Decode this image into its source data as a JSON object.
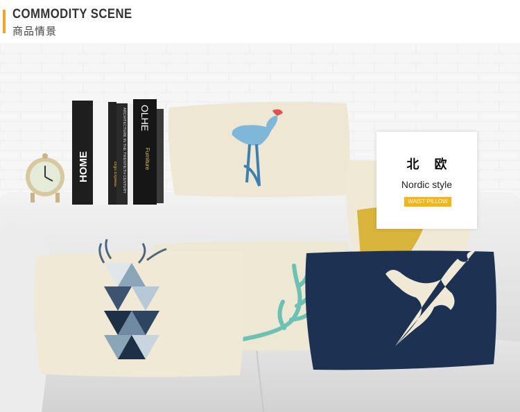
{
  "header": {
    "title": "COMMODITY SCENE",
    "subtitle": "商品情景",
    "accent_color": "#f5a623"
  },
  "product_label": {
    "name_cn": "北欧",
    "style_en": "Nordic style",
    "tag": "WAIST PILLOW",
    "tag_color": "#f5b41a"
  },
  "books": {
    "home": "HOME",
    "olhe": "OLHE",
    "furniture": "Furniture",
    "architecture": "ARCHITECTURE IN THE TWENTIETH CENTURY",
    "ergo": "Ergo Express"
  },
  "icons": {
    "flamingo": "flamingo-icon",
    "deer_geometric": "geometric-deer-icon",
    "antler": "antler-icon",
    "deer_silhouette": "deer-head-icon",
    "clock": "clock-icon"
  }
}
